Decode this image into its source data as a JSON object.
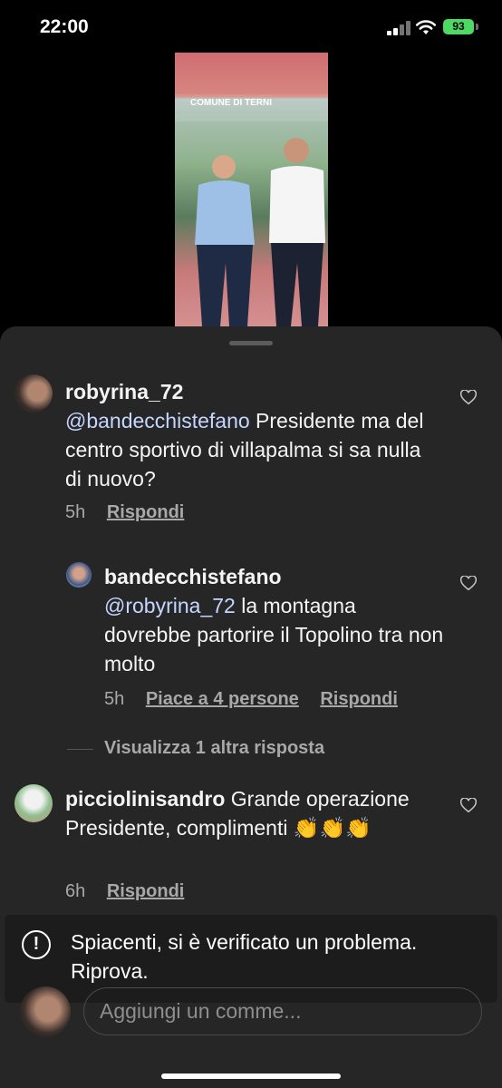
{
  "status_bar": {
    "time": "22:00",
    "battery": "93"
  },
  "story": {
    "sign_text": "COMUNE DI TERNI"
  },
  "comments": [
    {
      "username": "robyrina_72",
      "mention": "@bandecchistefano",
      "text": " Presidente ma del centro sportivo di villapalma si sa nulla di nuovo?",
      "time": "5h",
      "reply_label": "Rispondi"
    },
    {
      "username": "bandecchistefano",
      "mention": "@robyrina_72",
      "text": " la montagna dovrebbe partorire il Topolino tra non molto",
      "time": "5h",
      "likes_label": "Piace a 4 persone",
      "reply_label": "Rispondi"
    },
    {
      "username": "picciolinisandro",
      "text": " Grande operazione Presidente, complimenti 👏👏👏",
      "time": "6h",
      "reply_label": "Rispondi"
    }
  ],
  "view_more_replies": "Visualizza 1 altra risposta",
  "toast": {
    "icon": "exclamation-circle-icon",
    "message": "Spiacenti, si è verificato un problema. Riprova."
  },
  "comment_input": {
    "placeholder": "Aggiungi un comme..."
  },
  "colors": {
    "sheet_bg": "#262626",
    "mention": "#c5d6ff",
    "battery": "#4cd964"
  }
}
